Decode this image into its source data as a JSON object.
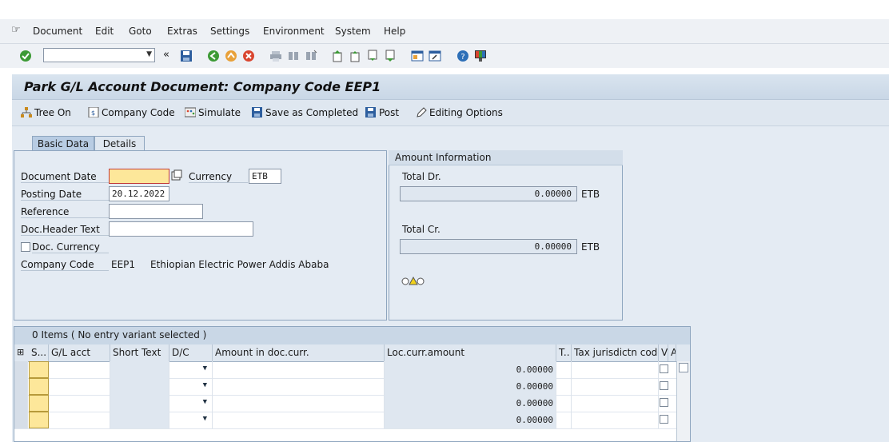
{
  "menu": {
    "items": [
      "Document",
      "Edit",
      "Goto",
      "Extras",
      "Settings",
      "Environment",
      "System",
      "Help"
    ]
  },
  "window": {
    "title": "Park G/L Account Document: Company Code EEP1"
  },
  "toolbar": {
    "command_value": "",
    "icons": [
      "enter-icon",
      "save-icon",
      "back-icon",
      "exit-icon",
      "cancel-icon",
      "print-icon",
      "find-icon",
      "find-next-icon",
      "first-page-icon",
      "prev-page-icon",
      "next-page-icon",
      "last-page-icon",
      "new-session-icon",
      "shortcut-icon",
      "help-icon",
      "layout-icon"
    ]
  },
  "app_toolbar": {
    "tree_on": "Tree On",
    "company_code": "Company Code",
    "simulate": "Simulate",
    "save_completed": "Save as Completed",
    "post": "Post",
    "editing_options": "Editing Options"
  },
  "tabs": {
    "basic_data": "Basic Data",
    "details": "Details"
  },
  "basic": {
    "document_date_label": "Document Date",
    "document_date_value": "",
    "currency_label": "Currency",
    "currency_value": "ETB",
    "posting_date_label": "Posting Date",
    "posting_date_value": "20.12.2022",
    "reference_label": "Reference",
    "reference_value": "",
    "header_text_label": "Doc.Header Text",
    "header_text_value": "",
    "doc_currency_label": "Doc. Currency",
    "company_code_label": "Company Code",
    "company_code_value": "EEP1",
    "company_name": "Ethiopian Electric Power Addis Ababa"
  },
  "amount_info": {
    "title": "Amount Information",
    "total_dr_label": "Total Dr.",
    "total_dr_value": "0.00000",
    "total_dr_currency": "ETB",
    "total_cr_label": "Total Cr.",
    "total_cr_value": "0.00000",
    "total_cr_currency": "ETB"
  },
  "items_table": {
    "title": "0 Items ( No entry variant selected )",
    "headers": {
      "s": "S...",
      "gl_acct": "G/L acct",
      "short_text": "Short Text",
      "dc": "D/C",
      "amount_doc": "Amount in doc.curr.",
      "loc_amount": "Loc.curr.amount",
      "t": "T..",
      "tax_jur": "Tax jurisdictn code",
      "v": "V",
      "a": "A"
    },
    "rows": [
      {
        "loc_amount": "0.00000"
      },
      {
        "loc_amount": "0.00000"
      },
      {
        "loc_amount": "0.00000"
      },
      {
        "loc_amount": "0.00000"
      }
    ]
  },
  "colors": {
    "required_field": "#fde79a",
    "title_bar": "#c9d7e6",
    "panel": "#e4ebf3"
  }
}
